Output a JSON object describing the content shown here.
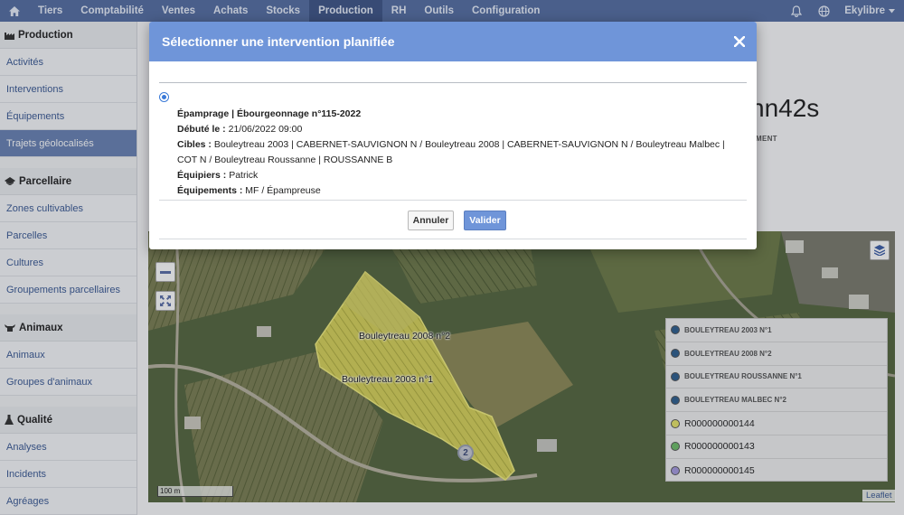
{
  "topnav": {
    "items": [
      "Tiers",
      "Comptabilité",
      "Ventes",
      "Achats",
      "Stocks",
      "Production",
      "RH",
      "Outils",
      "Configuration"
    ],
    "active_index": 5,
    "user": "Ekylibre"
  },
  "sidebar": {
    "sections": [
      {
        "title": "Production",
        "icon": "factory-icon",
        "items": [
          "Activités",
          "Interventions",
          "Équipements",
          "Trajets géolocalisés"
        ],
        "active": 3
      },
      {
        "title": "Parcellaire",
        "icon": "land-icon",
        "items": [
          "Zones cultivables",
          "Parcelles",
          "Cultures",
          "Groupements parcellaires"
        ]
      },
      {
        "title": "Animaux",
        "icon": "cow-icon",
        "items": [
          "Animaux",
          "Groupes d'animaux"
        ]
      },
      {
        "title": "Qualité",
        "icon": "flask-icon",
        "items": [
          "Analyses",
          "Incidents",
          "Agréages"
        ]
      }
    ]
  },
  "main": {
    "title_fragment": "nn42s",
    "sub_fragment": "MENT"
  },
  "map": {
    "labels": [
      "Bouleytreau 2008 n°2",
      "Bouleytreau 2003 n°1"
    ],
    "cluster_count": "2",
    "scale": "100 m",
    "attribution": "Leaflet",
    "legend": [
      {
        "label": "BOULEYTREAU 2003 N°1",
        "color": "#2f5f8f",
        "big": false
      },
      {
        "label": "BOULEYTREAU 2008 N°2",
        "color": "#2f5f8f",
        "big": false
      },
      {
        "label": "BOULEYTREAU ROUSSANNE N°1",
        "color": "#2f5f8f",
        "big": false
      },
      {
        "label": "BOULEYTREAU MALBEC N°2",
        "color": "#2f5f8f",
        "big": false
      },
      {
        "label": "R000000000144",
        "color": "#e8e56a",
        "big": true
      },
      {
        "label": "R000000000143",
        "color": "#6fbf6a",
        "big": true
      },
      {
        "label": "R000000000145",
        "color": "#a79be0",
        "big": true
      }
    ]
  },
  "modal": {
    "title": "Sélectionner une intervention planifiée",
    "intervention_name": "Épamprage | Ébourgeonnage n°115-2022",
    "started_label": "Débuté le :",
    "started_value": "21/06/2022 09:00",
    "targets_label": "Cibles :",
    "targets_value": "Bouleytreau 2003 | CABERNET-SAUVIGNON N / Bouleytreau 2008 | CABERNET-SAUVIGNON N / Bouleytreau Malbec | COT N / Bouleytreau Roussanne | ROUSSANNE B",
    "workers_label": "Équipiers :",
    "workers_value": "Patrick",
    "equipment_label": "Équipements :",
    "equipment_value": "MF / Épampreuse",
    "cancel_label": "Annuler",
    "confirm_label": "Valider"
  }
}
